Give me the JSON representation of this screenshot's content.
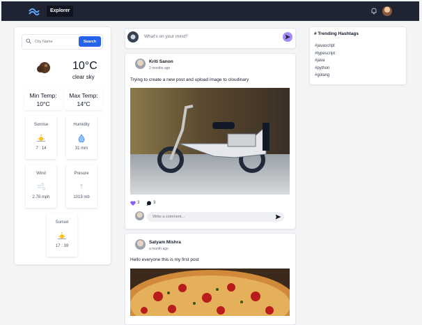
{
  "header": {
    "brand": "Explorer"
  },
  "weather": {
    "search_placeholder": "City Name",
    "search_label": "Search",
    "temp": "10°C",
    "condition": "clear sky",
    "min_label": "Min Temp:",
    "min_value": "10°C",
    "max_label": "Max Temp:",
    "max_value": "14°C",
    "tiles": [
      {
        "label": "Sunrise",
        "value": "7 : 14",
        "icon": "sunrise-icon"
      },
      {
        "label": "Humidity",
        "value": "31 mm",
        "icon": "droplet-icon"
      },
      {
        "label": "Wind",
        "value": "2.78 mph",
        "icon": "wind-icon"
      },
      {
        "label": "Presure",
        "value": "1019 mb",
        "icon": "pressure-icon"
      },
      {
        "label": "Sunset",
        "value": "17 : 39",
        "icon": "sunset-icon"
      }
    ]
  },
  "composer": {
    "placeholder": "What's on your mind?"
  },
  "posts": [
    {
      "author": "Kriti Sanon",
      "time": "2 months ago",
      "text": "Trying to create a new post and upload image to cloudinary",
      "likes": "3",
      "comments": "3",
      "comment_placeholder": "Write a comment..."
    },
    {
      "author": "Satyam Mishra",
      "time": "a month ago",
      "text": "Hello everyone this is my first post"
    }
  ],
  "trending": {
    "title": "# Trending Hashtags",
    "tags": [
      "#javascript",
      "#typescript",
      "#java",
      "#python",
      "#golang"
    ]
  },
  "colors": {
    "header": "#1e2433",
    "accent": "#2563eb",
    "send": "#a78bfa"
  }
}
